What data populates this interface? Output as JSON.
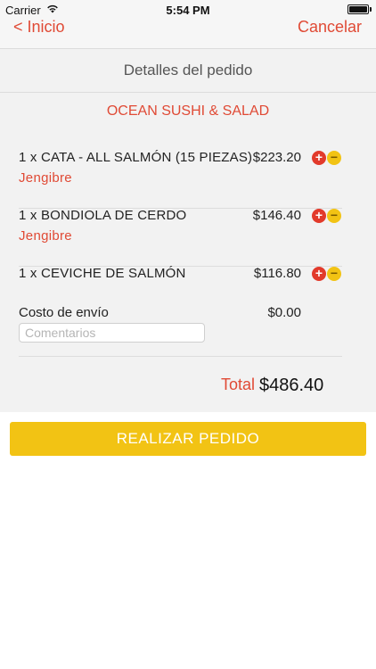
{
  "status_bar": {
    "carrier": "Carrier",
    "time": "5:54 PM",
    "wifi_icon": "wifi-icon",
    "battery_icon": "battery-icon",
    "battery_level": 1.0
  },
  "nav": {
    "back_label": "< Inicio",
    "cancel_label": "Cancelar"
  },
  "order": {
    "title": "Detalles del pedido",
    "restaurant": "OCEAN SUSHI & SALAD",
    "items": [
      {
        "name": "1 x CATA - ALL SALMÓN (15 PIEZAS)",
        "note": "Jengibre",
        "price": "$223.20"
      },
      {
        "name": "1 x BONDIOLA DE CERDO",
        "note": "Jengibre",
        "price": "$146.40"
      },
      {
        "name": "1 x CEVICHE DE SALMÓN",
        "note": "",
        "price": "$116.80"
      }
    ],
    "shipping_label": "Costo de envío",
    "shipping_price": "$0.00",
    "comments_placeholder": "Comentarios",
    "comments_value": "",
    "total_label": "Total",
    "total_value": "$486.40",
    "plus_icon": "plus-circle-icon",
    "minus_icon": "minus-circle-icon",
    "plus_symbol": "+",
    "minus_symbol": "−"
  },
  "actions": {
    "submit_label": "REALIZAR PEDIDO"
  },
  "colors": {
    "accent_red": "#e04a35",
    "accent_yellow": "#f2c314"
  }
}
